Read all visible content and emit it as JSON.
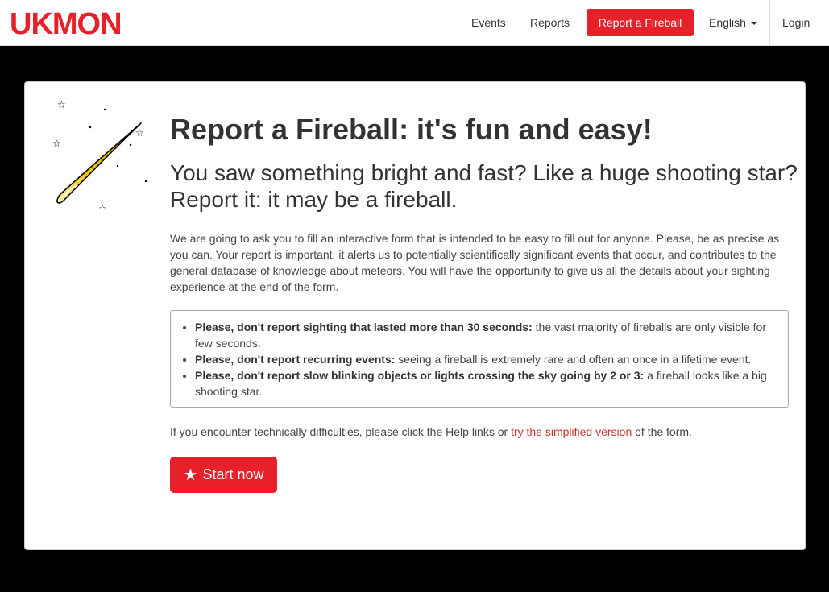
{
  "navbar": {
    "logo_text": "UKMON",
    "links": {
      "events": "Events",
      "reports": "Reports",
      "report_fireball": "Report a Fireball",
      "language": "English",
      "login": "Login"
    }
  },
  "main": {
    "title": "Report a Fireball: it's fun and easy!",
    "subtitle": "You saw something bright and fast? Like a huge shooting star? Report it: it may be a fireball.",
    "intro": "We are going to ask you to fill an interactive form that is intended to be easy to fill out for anyone. Please, be as precise as you can. Your report is important, it alerts us to potentially scientifically significant events that occur, and contributes to the general database of knowledge about meteors. You will have the opportunity to give us all the details about your sighting experience at the end of the form.",
    "warnings": [
      {
        "bold": "Please, don't report sighting that lasted more than 30 seconds:",
        "text": " the vast majority of fireballs are only visible for few seconds."
      },
      {
        "bold": "Please, don't report recurring events:",
        "text": " seeing a fireball is extremely rare and often an once in a lifetime event."
      },
      {
        "bold": "Please, don't report slow blinking objects or lights crossing the sky going by 2 or 3:",
        "text": " a fireball looks like a big shooting star."
      }
    ],
    "help": {
      "before": "If you encounter technically difficulties, please click the Help links or ",
      "link": "try the simplified version",
      "after": " of the form."
    },
    "start_button": {
      "icon": "star-icon",
      "label": "Start now"
    }
  },
  "colors": {
    "brand_red": "#e8202a",
    "link_red": "#c9302c",
    "background": "#000000"
  }
}
